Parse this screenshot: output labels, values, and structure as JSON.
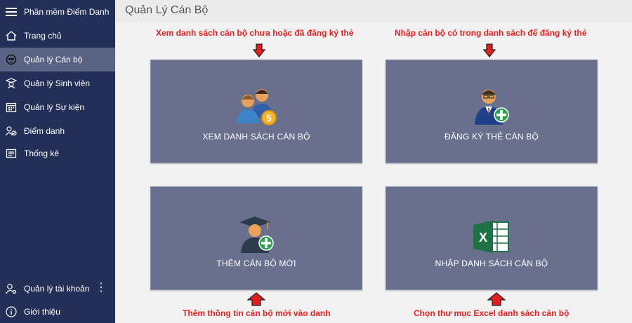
{
  "sidebar": {
    "app_title": "Phần mềm Điểm Danh",
    "items": [
      {
        "label": "Trang chủ"
      },
      {
        "label": "Quản lý Cán bộ"
      },
      {
        "label": "Quản lý Sinh viên"
      },
      {
        "label": "Quản lý Sự kiện"
      },
      {
        "label": "Điểm danh"
      },
      {
        "label": "Thống kê"
      }
    ],
    "bottom": [
      {
        "label": "Quản lý tài khoản"
      },
      {
        "label": "Giới thiệu"
      }
    ],
    "more_glyph": "⋮"
  },
  "main": {
    "title": "Quản Lý Cán Bộ",
    "tiles": [
      {
        "label": "XEM DANH SÁCH CÁN BỘ",
        "icon": "staff-group-icon"
      },
      {
        "label": "ĐĂNG KÝ THẺ CÁN BỘ",
        "icon": "register-card-icon"
      },
      {
        "label": "THÊM CÁN BỘ MỚI",
        "icon": "add-staff-icon"
      },
      {
        "label": "NHẬP DANH SÁCH CÁN BỘ",
        "icon": "excel-icon"
      }
    ],
    "annotations": [
      "Xem danh sách cán bộ chưa hoặc đã đăng ký thẻ",
      "Nhập cán bộ có trong danh sách để đăng ký thẻ",
      "Thêm thông tin cán bộ mới vào danh",
      "Chọn thư mục Excel danh sách cán bộ"
    ]
  },
  "colors": {
    "sidebar_bg": "#232f56",
    "sidebar_active": "#5a6384",
    "tile_bg": "#69708e",
    "annotation": "#e21f1f"
  }
}
